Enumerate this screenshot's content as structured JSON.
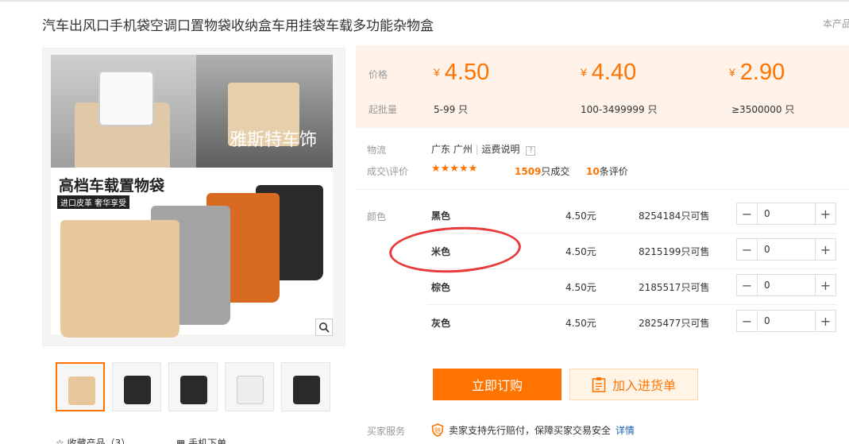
{
  "title": "汽车出风口手机袋空调口置物袋收纳盒车用挂袋车载多功能杂物盒",
  "corner_text": "本产品",
  "gallery": {
    "watermark": "雅斯特车饰",
    "banner_title": "高档车载置物袋",
    "banner_tag": "进口皮革  奢华享受",
    "thumbnails": [
      "thumb-1",
      "thumb-2",
      "thumb-3",
      "thumb-4",
      "thumb-5"
    ],
    "favorite_label": "收藏产品（3）",
    "mobile_label": "手机下单"
  },
  "pricing": {
    "price_label": "价格",
    "qty_label": "起批量",
    "currency": "¥",
    "tiers": [
      {
        "price": "4.50",
        "range": "5-99 只"
      },
      {
        "price": "4.40",
        "range": "100-3499999 只"
      },
      {
        "price": "2.90",
        "range": "≥3500000 只"
      }
    ]
  },
  "logistics": {
    "label": "物流",
    "location": "广东 广州",
    "shipping_link": "运费说明",
    "help_icon": "?"
  },
  "deal": {
    "label": "成交\\评价",
    "stars": "★★★★★",
    "sold_count": "1509",
    "sold_suffix": "只成交",
    "review_count": "10",
    "review_suffix": "条评价"
  },
  "variants": {
    "label": "颜色",
    "items": [
      {
        "name": "黑色",
        "price": "4.50元",
        "stock": "8254184只可售",
        "qty": "0"
      },
      {
        "name": "米色",
        "price": "4.50元",
        "stock": "8215199只可售",
        "qty": "0"
      },
      {
        "name": "棕色",
        "price": "4.50元",
        "stock": "2185517只可售",
        "qty": "0"
      },
      {
        "name": "灰色",
        "price": "4.50元",
        "stock": "2825477只可售",
        "qty": "0"
      }
    ],
    "minus": "−",
    "plus": "+"
  },
  "actions": {
    "buy_label": "立即订购",
    "cart_label": "加入进货单"
  },
  "service": {
    "label": "买家服务",
    "text": "卖家支持先行赔付，保障买家交易安全",
    "link": "详情"
  },
  "colors": {
    "accent": "#ff7300",
    "price_bg": "#fff2e8",
    "annotation": "#e83a3a"
  }
}
